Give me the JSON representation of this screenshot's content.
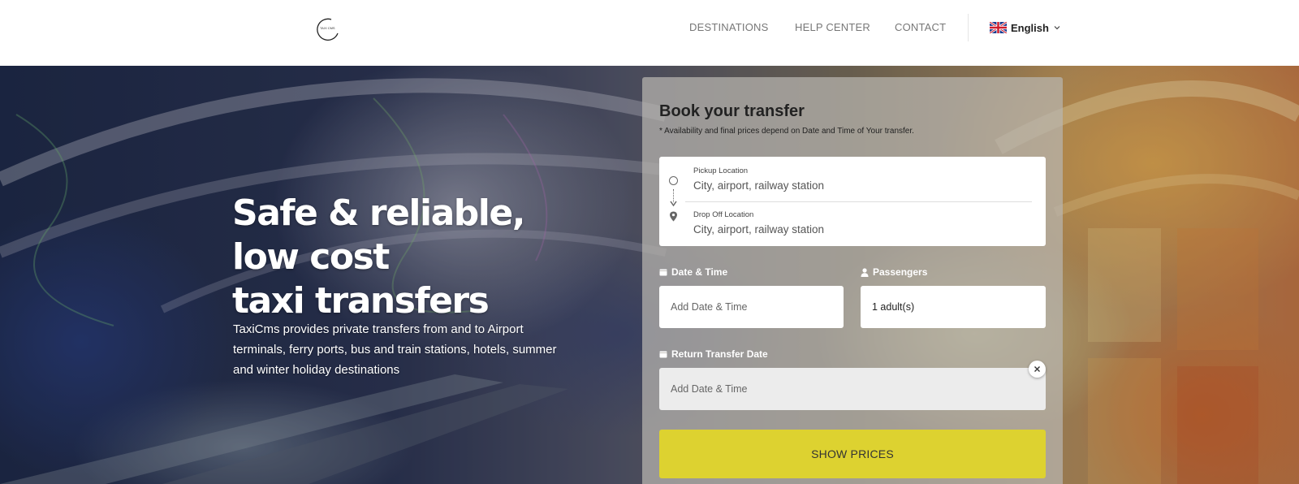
{
  "header": {
    "logo_text": "TAXI CMS",
    "nav": {
      "destinations": "DESTINATIONS",
      "help_center": "HELP CENTER",
      "contact": "CONTACT"
    },
    "language": {
      "label": "English",
      "flag_icon": "uk-flag-icon"
    }
  },
  "hero": {
    "headline_lines": [
      "Safe & reliable,",
      "low cost",
      "taxi transfers"
    ],
    "tagline": "TaxiCms provides private transfers from and to Airport terminals, ferry ports, bus and train stations, hotels, summer and winter holiday destinations"
  },
  "booking": {
    "title": "Book your transfer",
    "note": "* Availability and final prices depend on Date and Time of Your transfer.",
    "pickup": {
      "label": "Pickup Location",
      "placeholder": "City, airport, railway station"
    },
    "dropoff": {
      "label": "Drop Off Location",
      "placeholder": "City, airport, railway station"
    },
    "date": {
      "label": "Date & Time",
      "placeholder": "Add Date & Time",
      "icon": "calendar-icon"
    },
    "passengers": {
      "label": "Passengers",
      "value": "1 adult(s)",
      "icon": "user-icon"
    },
    "return_date": {
      "label": "Return Transfer Date",
      "placeholder": "Add Date & Time",
      "icon": "calendar-icon"
    },
    "submit_label": "SHOW PRICES"
  },
  "colors": {
    "accent_button": "#ddd230",
    "nav_text": "#777777",
    "panel_overlay": "rgba(185,182,176,0.72)"
  }
}
